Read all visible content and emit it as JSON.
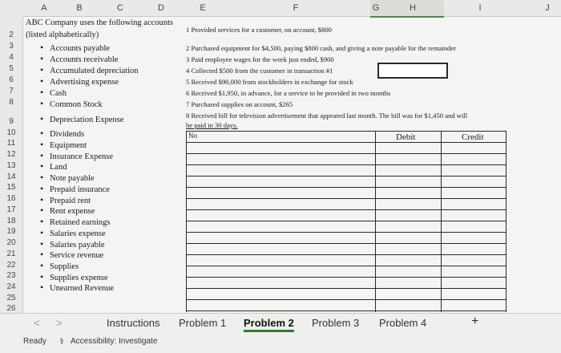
{
  "columns": [
    "A",
    "B",
    "C",
    "D",
    "E",
    "F",
    "G",
    "H",
    "I",
    "J"
  ],
  "rows": [
    "2",
    "3",
    "4",
    "5",
    "6",
    "7",
    "8",
    "9",
    "10",
    "11",
    "12",
    "13",
    "14",
    "15",
    "16",
    "17",
    "18",
    "19",
    "20",
    "21",
    "22",
    "23",
    "24",
    "25",
    "26"
  ],
  "intro": {
    "line1": "ABC Company uses the following accounts",
    "line2": "(listed alphabetically)"
  },
  "accounts": [
    "Accounts payable",
    "Accounts receivable",
    "Accumulated depreciation",
    "Advertising expense",
    "Cash",
    "Common Stock",
    "Depreciation Expense",
    "Dividends",
    "Equipment",
    "Insurance Expense",
    "Land",
    "Note payable",
    "Prepaid insurance",
    "Prepaid rent",
    "Rent expense",
    "Retained earnings",
    "Salaries expense",
    "Salaries payable",
    "Service revenue",
    "Supplies",
    "Supplies expense",
    "Unearned Revenue"
  ],
  "transactions": [
    "1  Provided services for a customer, on account, $800",
    "2  Purchased equipment for $4,500, paying $800 cash, and giving a note payable for the remainder",
    "3  Paid employee wages for the week just ended, $900",
    "4  Collected $500 from the customer in transaction #1",
    "5  Received $90,000 from stockholders in exchange for stock",
    "6  Received $1,950, in advance, for a service to be provided in two months",
    "7  Purchased supplies on account, $265",
    "8  Received bill for television advertisement that appeared last month.  The bill was for $1,450 and will",
    "be paid in 30 days."
  ],
  "journal": {
    "no_label": "No",
    "debit_label": "Debit",
    "credit_label": "Credit"
  },
  "tabs": {
    "prev": "<",
    "next": ">",
    "items": [
      "Instructions",
      "Problem 1",
      "Problem 2",
      "Problem 3",
      "Problem 4"
    ],
    "add": "+"
  },
  "status": {
    "ready": "Ready",
    "accessibility": "Accessibility: Investigate"
  }
}
